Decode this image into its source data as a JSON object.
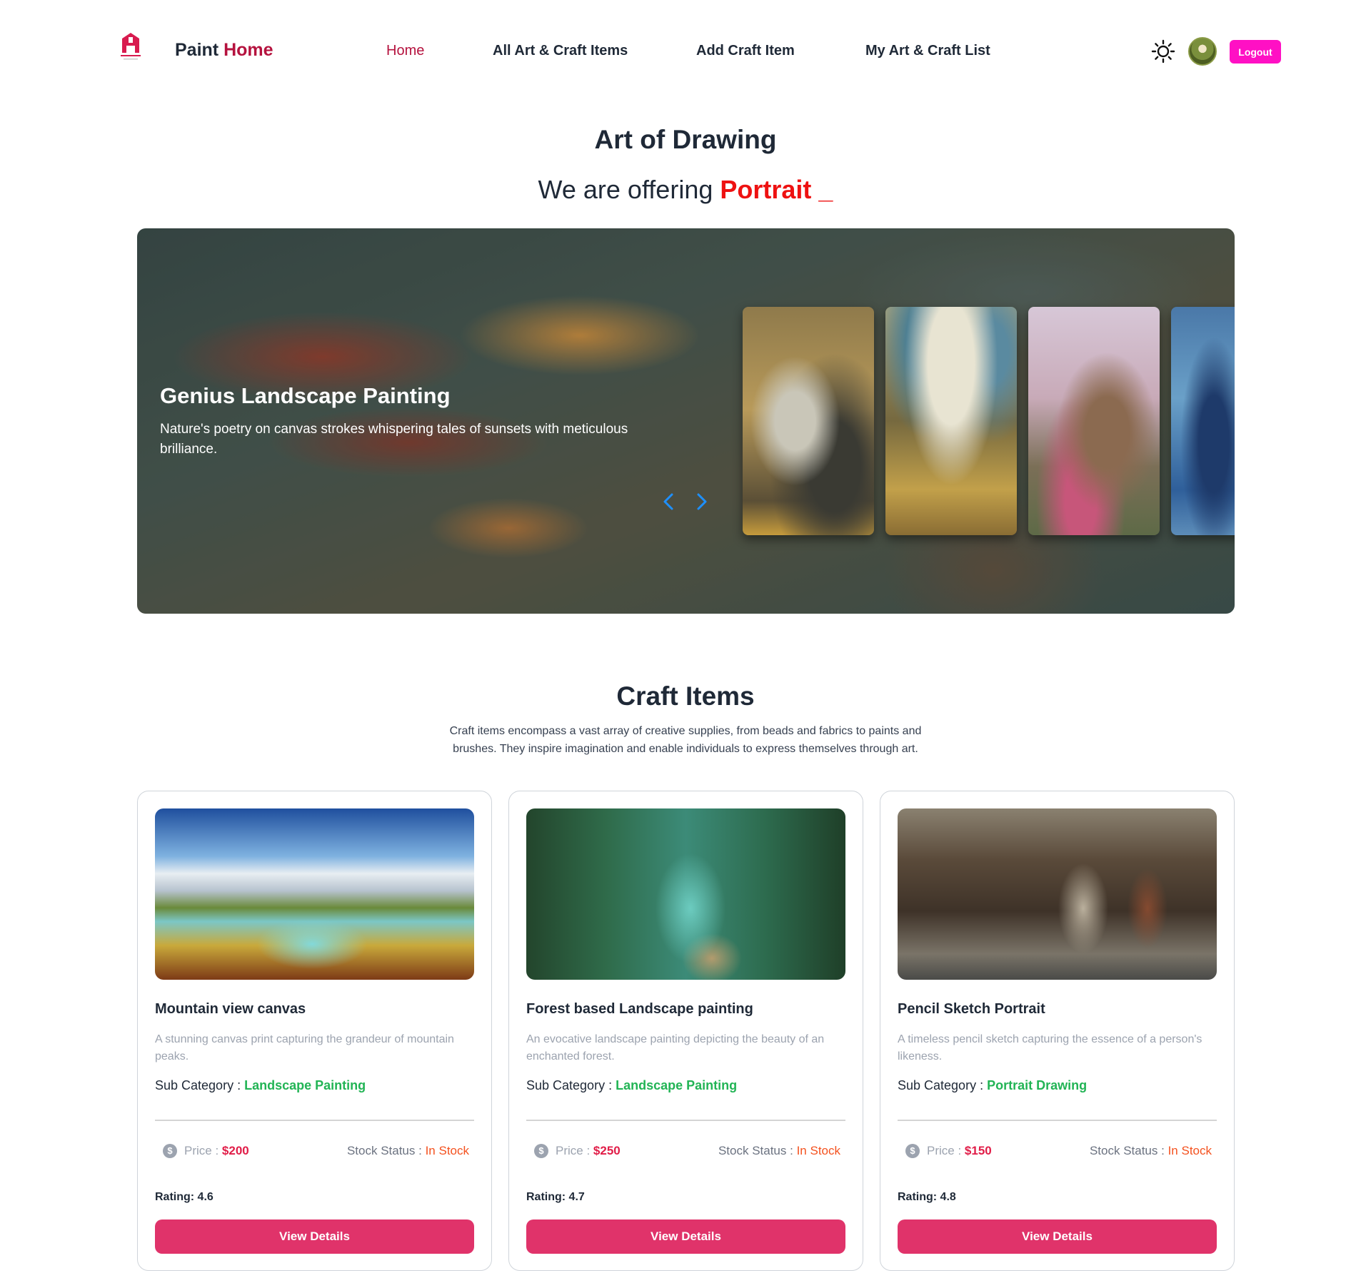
{
  "navbar": {
    "brand_part1": "Paint",
    "brand_part2": "Home",
    "links": [
      "Home",
      "All Art & Craft Items",
      "Add Craft Item",
      "My Art & Craft List"
    ],
    "logout_label": "Logout"
  },
  "hero": {
    "title": "Art of Drawing",
    "subtitle_prefix": "We are offering",
    "subtitle_typed": "Portrait",
    "cursor": "_"
  },
  "banner": {
    "title": "Genius Landscape Painting",
    "description": "Nature's poetry on canvas strokes whispering tales of sunsets with meticulous brilliance."
  },
  "craft_section": {
    "title": "Craft Items",
    "description": "Craft items encompass a vast array of creative supplies, from beads and fabrics to paints and brushes. They inspire imagination and enable individuals to express themselves through art."
  },
  "cards": [
    {
      "title": "Mountain view canvas",
      "description": "A stunning canvas print capturing the grandeur of mountain peaks.",
      "sub_label": "Sub Category :",
      "sub_value": "Landscape Painting",
      "price_label": "Price :",
      "price": "$200",
      "stock_label": "Stock Status :",
      "stock_value": "In Stock",
      "rating": "Rating: 4.6",
      "button": "View Details"
    },
    {
      "title": "Forest based Landscape painting",
      "description": "An evocative landscape painting depicting the beauty of an enchanted forest.",
      "sub_label": "Sub Category :",
      "sub_value": "Landscape Painting",
      "price_label": "Price :",
      "price": "$250",
      "stock_label": "Stock Status :",
      "stock_value": "In Stock",
      "rating": "Rating: 4.7",
      "button": "View Details"
    },
    {
      "title": "Pencil Sketch Portrait",
      "description": "A timeless pencil sketch capturing the essence of a person's likeness.",
      "sub_label": "Sub Category :",
      "sub_value": "Portrait Drawing",
      "price_label": "Price :",
      "price": "$150",
      "stock_label": "Stock Status :",
      "stock_value": "In Stock",
      "rating": "Rating: 4.8",
      "button": "View Details"
    }
  ],
  "icons": {
    "theme_toggle": "sun-icon",
    "price": "dollar-icon",
    "prev": "chevron-left-icon",
    "next": "chevron-right-icon"
  },
  "colors": {
    "brand_accent": "#b5123e",
    "logout_bg": "#ff10c4",
    "typed_text": "#ee1111",
    "sub_category": "#22b455",
    "price": "#e11d48",
    "stock": "#f4511e",
    "button_bg": "#e0336a"
  }
}
